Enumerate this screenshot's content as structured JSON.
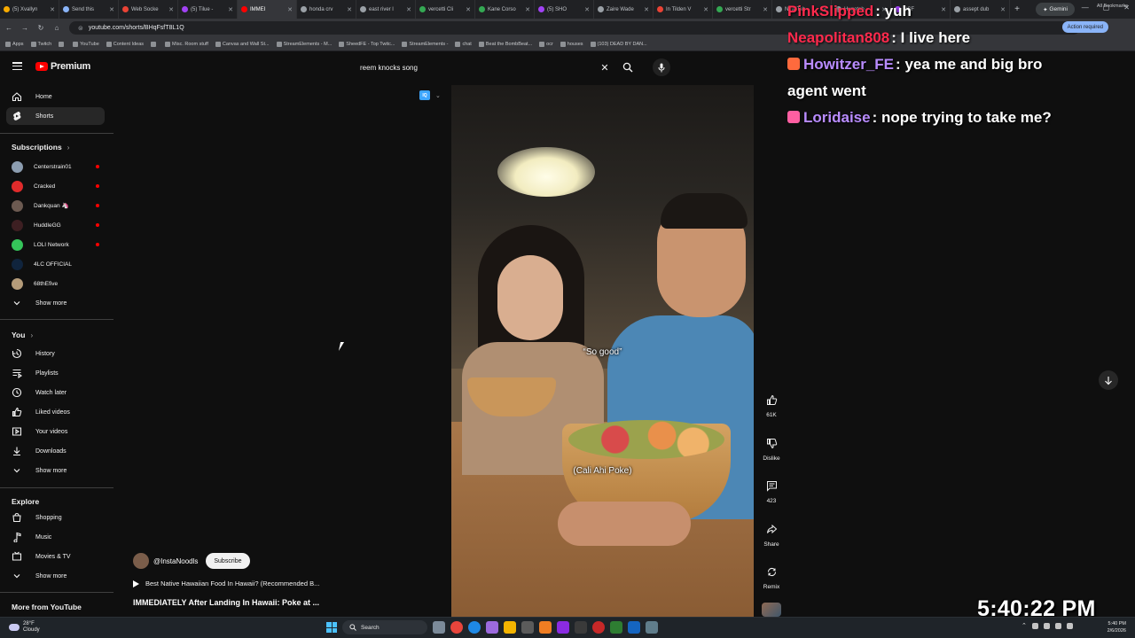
{
  "browser": {
    "tabs": [
      {
        "label": "(5) Xvallyn",
        "color": "#f9ab00"
      },
      {
        "label": "Send this",
        "color": "#8ab4f8"
      },
      {
        "label": "Web Socke",
        "color": "#ea4335"
      },
      {
        "label": "(5) Tilue -",
        "color": "#a142f4"
      },
      {
        "label": "IMMEI",
        "color": "#ff0000"
      },
      {
        "label": "honda crv",
        "color": "#9aa0a6"
      },
      {
        "label": "east river l",
        "color": "#9aa0a6"
      },
      {
        "label": "vercetti Cli",
        "color": "#34a853"
      },
      {
        "label": "Kane Corso",
        "color": "#34a853"
      },
      {
        "label": "(5) SHO",
        "color": "#a142f4"
      },
      {
        "label": "Zaire Wade",
        "color": "#9aa0a6"
      },
      {
        "label": "In Tilden V",
        "color": "#ea4335"
      },
      {
        "label": "vercetti Str",
        "color": "#34a853"
      },
      {
        "label": "New Tab",
        "color": "#9aa0a6"
      },
      {
        "label": "Hugetab",
        "color": "#9aa0a6"
      },
      {
        "label": "NSF",
        "color": "#a142f4"
      },
      {
        "label": "assept dub",
        "color": "#9aa0a6"
      }
    ],
    "gemini_label": "Gemini",
    "url": "youtube.com/shorts/BHqFsfT8L1Q",
    "action_required": "Action required",
    "bookmarks": [
      "Apps",
      "Twitch",
      "",
      "YouTube",
      "Content Ideas",
      "",
      "Misc. Room stuff",
      "Canvas and Wall St...",
      "StreamElements - M...",
      "SheedFE - Top Twitc...",
      "StreamElements -",
      "chat",
      "Beat the BombBeat...",
      "ocr",
      "houses",
      "(103) DEAD BY DAN..."
    ],
    "all_bookmarks": "All Bookmarks"
  },
  "youtube": {
    "logo_text": "Premium",
    "search_query": "reem knocks song",
    "sidebar": {
      "main": [
        {
          "label": "Home",
          "icon": "home-icon"
        },
        {
          "label": "Shorts",
          "icon": "shorts-icon",
          "active": true
        }
      ],
      "subscriptions_heading": "Subscriptions",
      "subscriptions": [
        {
          "label": "Centerstrain01",
          "color": "#8c9db0",
          "live": true
        },
        {
          "label": "Cracked",
          "color": "#e02b2b",
          "live": true
        },
        {
          "label": "Dankquan 🦄",
          "color": "#6c5a51",
          "live": true
        },
        {
          "label": "HuddleGG",
          "color": "#3d1f22",
          "live": true
        },
        {
          "label": "LOLI Network",
          "color": "#35c45a",
          "live": true
        },
        {
          "label": "4LC OFFICIAL",
          "color": "#10243d",
          "live": false
        },
        {
          "label": "68thEfive",
          "color": "#b59c7a",
          "live": false
        }
      ],
      "subs_show_more": "Show more",
      "you_heading": "You",
      "you_items": [
        {
          "label": "History",
          "icon": "history-icon"
        },
        {
          "label": "Playlists",
          "icon": "playlists-icon"
        },
        {
          "label": "Watch later",
          "icon": "watch-later-icon"
        },
        {
          "label": "Liked videos",
          "icon": "like-icon"
        },
        {
          "label": "Your videos",
          "icon": "your-videos-icon"
        },
        {
          "label": "Downloads",
          "icon": "download-icon"
        }
      ],
      "you_show_more": "Show more",
      "explore_heading": "Explore",
      "explore_items": [
        {
          "label": "Shopping",
          "icon": "shopping-icon"
        },
        {
          "label": "Music",
          "icon": "music-icon"
        },
        {
          "label": "Movies & TV",
          "icon": "movies-icon"
        }
      ],
      "explore_show_more": "Show more",
      "more_heading": "More from YouTube"
    },
    "short": {
      "caption_top": "“So good”",
      "caption_bottom": "(Cali Ahi Poke)",
      "quality_badge": "IQ",
      "channel": "@InstaNoodls",
      "subscribe_label": "Subscribe",
      "music": "Best Native Hawaiian Food In Hawaii? (Recommended B...",
      "title": "IMMEDIATELY After Landing In Hawaii: Poke at ...",
      "likes": "61K",
      "dislike_label": "Dislike",
      "comments": "423",
      "share_label": "Share",
      "remix_label": "Remix"
    }
  },
  "stream_overlay": {
    "chat": [
      {
        "user": "PinkSlipped",
        "sep": ":",
        "msg": "yuh",
        "color": "#ff2a4d",
        "badge": ""
      },
      {
        "user": "Neapolitan808",
        "sep": ":",
        "msg": "I live here",
        "color": "#ff2a4d",
        "badge": ""
      },
      {
        "user": "Howitzer_FE",
        "sep": ":",
        "msg": "yea me and big bro",
        "color": "#b98cff",
        "badge": "#ff6a3d"
      },
      {
        "user": "",
        "sep": "",
        "msg": "agent went",
        "color": "#fff",
        "badge": ""
      },
      {
        "user": "Loridaise",
        "sep": ":",
        "msg": "nope trying to take me?",
        "color": "#b98cff",
        "badge": "#ff5fa2"
      }
    ],
    "clock": "5:40:22 PM"
  },
  "taskbar": {
    "temp": "28°F",
    "weather": "Cloudy",
    "search_label": "Search",
    "time": "5:40 PM",
    "date": "2/6/2026"
  }
}
